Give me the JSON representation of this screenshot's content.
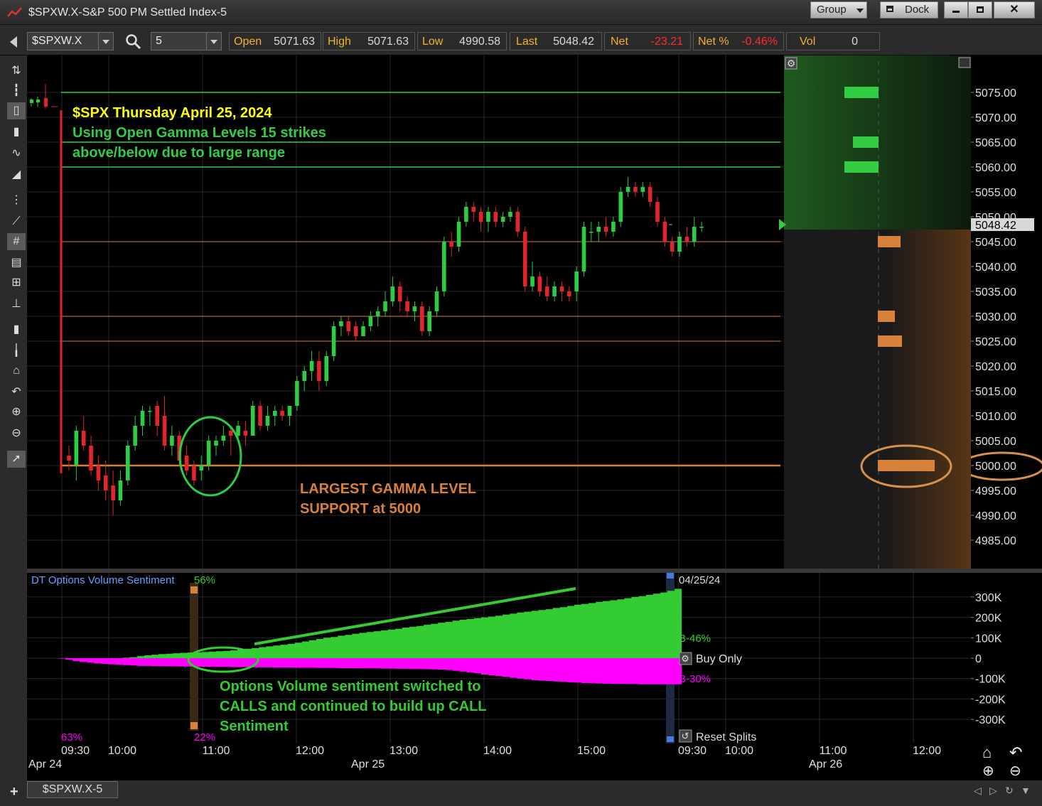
{
  "window": {
    "title": "$SPXW.X-S&P 500 PM Settled Index-5",
    "group_label": "Group",
    "dock_label": "Dock",
    "minimize_icon": "minimize-icon",
    "maximize_icon": "maximize-icon",
    "close_icon": "close-icon"
  },
  "toolbar": {
    "symbol": "$SPXW.X",
    "interval": "5",
    "quote": {
      "open_label": "Open",
      "open_value": "5071.63",
      "high_label": "High",
      "high_value": "5071.63",
      "low_label": "Low",
      "low_value": "4990.58",
      "last_label": "Last",
      "last_value": "5048.42",
      "net_label": "Net",
      "net_value": "-23.21",
      "netpct_label": "Net %",
      "netpct_value": "-0.46%",
      "vol_label": "Vol",
      "vol_value": "0"
    }
  },
  "annotations": {
    "title_line": "$SPX Thursday April 25, 2024",
    "gamma_line1": "Using Open Gamma Levels 15 strikes",
    "gamma_line2": "above/below due to large range",
    "support_line1": "LARGEST GAMMA LEVEL",
    "support_line2": "SUPPORT at 5000",
    "sentiment_line1": "Options Volume sentiment switched to",
    "sentiment_line2": "CALLS and continued to build up CALL",
    "sentiment_line3": "Sentiment"
  },
  "price_axis": {
    "ticks": [
      "5075.00",
      "5070.00",
      "5065.00",
      "5060.00",
      "5055.00",
      "5050.00",
      "5045.00",
      "5040.00",
      "5035.00",
      "5030.00",
      "5025.00",
      "5020.00",
      "5015.00",
      "5010.00",
      "5005.00",
      "5000.00",
      "4995.00",
      "4990.00",
      "4985.00"
    ],
    "last_price_label": "5048.42"
  },
  "indicator": {
    "name": "DT Options Volume Sentiment",
    "top_pct": "56%",
    "bottom_left_pct": "63%",
    "bottom_pct": "22%",
    "date_label": "04/25/24",
    "buy_label": "B-46%",
    "sell_label": "B-30%",
    "buy_only_label": "Buy Only",
    "reset_splits_label": "Reset Splits",
    "axis_ticks": [
      "300K",
      "200K",
      "100K",
      "0",
      "-100K",
      "-200K",
      "-300K"
    ]
  },
  "time_axis": {
    "times": [
      "09:30",
      "10:00",
      "11:00",
      "12:00",
      "13:00",
      "14:00",
      "15:00",
      "09:30",
      "10:00",
      "11:00",
      "12:00"
    ],
    "dates": [
      "Apr 24",
      "Apr 25",
      "Apr 26"
    ]
  },
  "bottom": {
    "tab_label": "$SPXW.X-5"
  },
  "colors": {
    "up_candle": "#2ecc40",
    "down_candle": "#e0262b",
    "gamma_call": "#33cc44",
    "gamma_put": "#d7813a",
    "sentiment_calls": "#33cc33",
    "sentiment_puts": "#ff00ff",
    "quote_label": "#f0b030"
  },
  "chart_data": {
    "type": "candlestick",
    "interval_minutes": 5,
    "ylim": [
      4981,
      5080
    ],
    "gamma_levels_call": [
      5075,
      5065,
      5060
    ],
    "gamma_levels_put": [
      5045,
      5030,
      5025,
      5000
    ],
    "candles": [
      {
        "o": 5002,
        "h": 5004,
        "l": 4999,
        "c": 5001
      },
      {
        "o": 5000,
        "h": 5008,
        "l": 4997,
        "c": 5007
      },
      {
        "o": 5007,
        "h": 5010,
        "l": 5003,
        "c": 5004
      },
      {
        "o": 5004,
        "h": 5006,
        "l": 4998,
        "c": 4999
      },
      {
        "o": 5000,
        "h": 5002,
        "l": 4995,
        "c": 4997
      },
      {
        "o": 4998,
        "h": 5001,
        "l": 4993,
        "c": 4995
      },
      {
        "o": 4996,
        "h": 4999,
        "l": 4990,
        "c": 4993
      },
      {
        "o": 4993,
        "h": 4999,
        "l": 4992,
        "c": 4997
      },
      {
        "o": 4997,
        "h": 5005,
        "l": 4996,
        "c": 5004
      },
      {
        "o": 5004,
        "h": 5010,
        "l": 5003,
        "c": 5008
      },
      {
        "o": 5008,
        "h": 5012,
        "l": 5006,
        "c": 5011
      },
      {
        "o": 5011,
        "h": 5012,
        "l": 5008,
        "c": 5011
      },
      {
        "o": 5012,
        "h": 5013,
        "l": 5006,
        "c": 5008
      },
      {
        "o": 5010,
        "h": 5014,
        "l": 5003,
        "c": 5004
      },
      {
        "o": 5004,
        "h": 5008,
        "l": 5002,
        "c": 5006
      },
      {
        "o": 5006,
        "h": 5007,
        "l": 5000,
        "c": 5001
      },
      {
        "o": 5002,
        "h": 5004,
        "l": 4998,
        "c": 4999
      },
      {
        "o": 5000,
        "h": 5001,
        "l": 4996,
        "c": 4997
      },
      {
        "o": 4999,
        "h": 5002,
        "l": 4997,
        "c": 5000
      },
      {
        "o": 5000,
        "h": 5006,
        "l": 4999,
        "c": 5005
      },
      {
        "o": 5004,
        "h": 5006,
        "l": 5002,
        "c": 5005
      },
      {
        "o": 5005,
        "h": 5008,
        "l": 5004,
        "c": 5006
      },
      {
        "o": 5007,
        "h": 5008,
        "l": 5002,
        "c": 5006
      },
      {
        "o": 5006,
        "h": 5009,
        "l": 5005,
        "c": 5008
      },
      {
        "o": 5007,
        "h": 5009,
        "l": 5004,
        "c": 5006
      },
      {
        "o": 5006,
        "h": 5013,
        "l": 5006,
        "c": 5012
      },
      {
        "o": 5012,
        "h": 5013,
        "l": 5007,
        "c": 5008
      },
      {
        "o": 5008,
        "h": 5012,
        "l": 5007,
        "c": 5010
      },
      {
        "o": 5010,
        "h": 5012,
        "l": 5008,
        "c": 5011
      },
      {
        "o": 5011,
        "h": 5012,
        "l": 5009,
        "c": 5010
      },
      {
        "o": 5010,
        "h": 5012,
        "l": 5008,
        "c": 5012
      },
      {
        "o": 5012,
        "h": 5018,
        "l": 5011,
        "c": 5017
      },
      {
        "o": 5017,
        "h": 5020,
        "l": 5015,
        "c": 5019
      },
      {
        "o": 5019,
        "h": 5023,
        "l": 5017,
        "c": 5021
      },
      {
        "o": 5021,
        "h": 5023,
        "l": 5015,
        "c": 5017
      },
      {
        "o": 5017,
        "h": 5023,
        "l": 5016,
        "c": 5022
      },
      {
        "o": 5022,
        "h": 5029,
        "l": 5021,
        "c": 5028
      },
      {
        "o": 5028,
        "h": 5030,
        "l": 5026,
        "c": 5029
      },
      {
        "o": 5029,
        "h": 5030,
        "l": 5026,
        "c": 5027
      },
      {
        "o": 5028,
        "h": 5029,
        "l": 5025,
        "c": 5026
      },
      {
        "o": 5026,
        "h": 5029,
        "l": 5026,
        "c": 5028
      },
      {
        "o": 5028,
        "h": 5031,
        "l": 5027,
        "c": 5030
      },
      {
        "o": 5030,
        "h": 5032,
        "l": 5028,
        "c": 5031
      },
      {
        "o": 5031,
        "h": 5035,
        "l": 5030,
        "c": 5033
      },
      {
        "o": 5033,
        "h": 5038,
        "l": 5032,
        "c": 5036
      },
      {
        "o": 5036,
        "h": 5037,
        "l": 5031,
        "c": 5033
      },
      {
        "o": 5033,
        "h": 5034,
        "l": 5030,
        "c": 5031
      },
      {
        "o": 5031,
        "h": 5033,
        "l": 5029,
        "c": 5032
      },
      {
        "o": 5032,
        "h": 5033,
        "l": 5026,
        "c": 5027
      },
      {
        "o": 5027,
        "h": 5032,
        "l": 5026,
        "c": 5031
      },
      {
        "o": 5031,
        "h": 5036,
        "l": 5030,
        "c": 5035
      },
      {
        "o": 5035,
        "h": 5046,
        "l": 5034,
        "c": 5045
      },
      {
        "o": 5045,
        "h": 5047,
        "l": 5042,
        "c": 5044
      },
      {
        "o": 5044,
        "h": 5050,
        "l": 5043,
        "c": 5049
      },
      {
        "o": 5049,
        "h": 5053,
        "l": 5048,
        "c": 5052
      },
      {
        "o": 5052,
        "h": 5053,
        "l": 5049,
        "c": 5051
      },
      {
        "o": 5051,
        "h": 5052,
        "l": 5047,
        "c": 5049
      },
      {
        "o": 5049,
        "h": 5052,
        "l": 5047,
        "c": 5051
      },
      {
        "o": 5051,
        "h": 5052,
        "l": 5048,
        "c": 5049
      },
      {
        "o": 5049,
        "h": 5051,
        "l": 5048,
        "c": 5050
      },
      {
        "o": 5050,
        "h": 5052,
        "l": 5049,
        "c": 5051
      },
      {
        "o": 5051,
        "h": 5052,
        "l": 5046,
        "c": 5047
      },
      {
        "o": 5047,
        "h": 5048,
        "l": 5035,
        "c": 5036
      },
      {
        "o": 5036,
        "h": 5041,
        "l": 5035,
        "c": 5038
      },
      {
        "o": 5038,
        "h": 5039,
        "l": 5034,
        "c": 5035
      },
      {
        "o": 5036,
        "h": 5038,
        "l": 5033,
        "c": 5034
      },
      {
        "o": 5034,
        "h": 5037,
        "l": 5033,
        "c": 5036
      },
      {
        "o": 5036,
        "h": 5037,
        "l": 5033,
        "c": 5035
      },
      {
        "o": 5035,
        "h": 5036,
        "l": 5033,
        "c": 5034
      },
      {
        "o": 5035,
        "h": 5040,
        "l": 5033,
        "c": 5039
      },
      {
        "o": 5039,
        "h": 5049,
        "l": 5038,
        "c": 5048
      },
      {
        "o": 5047,
        "h": 5049,
        "l": 5045,
        "c": 5047
      },
      {
        "o": 5047,
        "h": 5049,
        "l": 5045,
        "c": 5048
      },
      {
        "o": 5048,
        "h": 5050,
        "l": 5046,
        "c": 5047
      },
      {
        "o": 5047,
        "h": 5050,
        "l": 5046,
        "c": 5049
      },
      {
        "o": 5049,
        "h": 5056,
        "l": 5048,
        "c": 5055
      },
      {
        "o": 5055,
        "h": 5058,
        "l": 5054,
        "c": 5056
      },
      {
        "o": 5056,
        "h": 5057,
        "l": 5054,
        "c": 5055
      },
      {
        "o": 5055,
        "h": 5057,
        "l": 5054,
        "c": 5056
      },
      {
        "o": 5056,
        "h": 5057,
        "l": 5052,
        "c": 5053
      },
      {
        "o": 5053,
        "h": 5054,
        "l": 5048,
        "c": 5049
      },
      {
        "o": 5049,
        "h": 5050,
        "l": 5044,
        "c": 5045
      },
      {
        "o": 5045,
        "h": 5046,
        "l": 5042,
        "c": 5043
      },
      {
        "o": 5043,
        "h": 5047,
        "l": 5042,
        "c": 5046
      },
      {
        "o": 5046,
        "h": 5048,
        "l": 5044,
        "c": 5045
      },
      {
        "o": 5045,
        "h": 5050,
        "l": 5044,
        "c": 5048
      },
      {
        "o": 5048,
        "h": 5049,
        "l": 5047,
        "c": 5048
      }
    ]
  }
}
